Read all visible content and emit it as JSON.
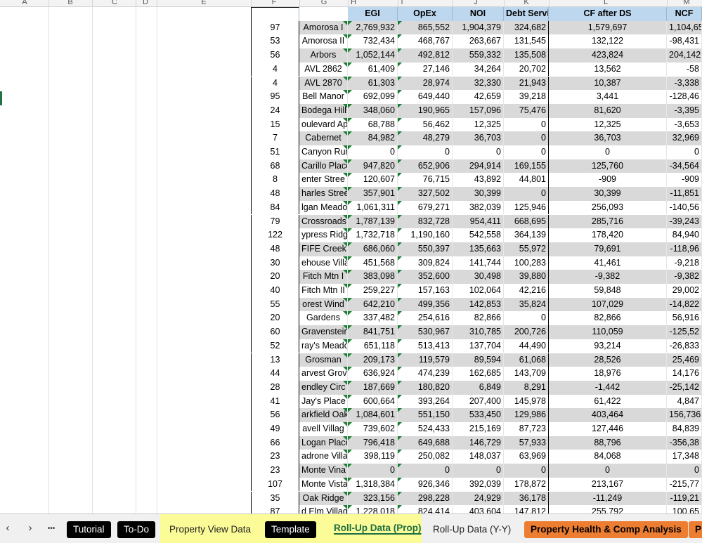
{
  "sheet": {
    "col_letters": [
      "A",
      "B",
      "C",
      "D",
      "E",
      "F",
      "G",
      "H",
      "I",
      "J",
      "K",
      "L",
      "M"
    ],
    "headers": {
      "egi": "EGI",
      "opex": "OpEx",
      "noi": "NOI",
      "debt": "Debt Service",
      "cf": "CF after DS",
      "ncf": "NCF"
    },
    "rows": [
      {
        "count": "97",
        "name": "Amorosa I",
        "egi": "2,769,932",
        "opex": "865,552",
        "noi": "1,904,379",
        "debt": "324,682",
        "cf": "1,579,697",
        "ncf": "1,104,65"
      },
      {
        "count": "53",
        "name": "Amorosa II",
        "egi": "732,434",
        "opex": "468,767",
        "noi": "263,667",
        "debt": "131,545",
        "cf": "132,122",
        "ncf": "-98,431"
      },
      {
        "count": "56",
        "name": "Arbors",
        "egi": "1,052,144",
        "opex": "492,812",
        "noi": "559,332",
        "debt": "135,508",
        "cf": "423,824",
        "ncf": "204,142"
      },
      {
        "count": "4",
        "name": "AVL 2862",
        "egi": "61,409",
        "opex": "27,146",
        "noi": "34,264",
        "debt": "20,702",
        "cf": "13,562",
        "ncf": "-58"
      },
      {
        "count": "4",
        "name": "AVL 2870",
        "egi": "61,303",
        "opex": "28,974",
        "noi": "32,330",
        "debt": "21,943",
        "cf": "10,387",
        "ncf": "-3,338"
      },
      {
        "count": "95",
        "name": "Bell Manor",
        "egi": "692,099",
        "opex": "649,440",
        "noi": "42,659",
        "debt": "39,218",
        "cf": "3,441",
        "ncf": "-128,46"
      },
      {
        "count": "24",
        "name": "Bodega Hills",
        "egi": "348,060",
        "opex": "190,965",
        "noi": "157,096",
        "debt": "75,476",
        "cf": "81,620",
        "ncf": "-3,395"
      },
      {
        "count": "15",
        "name": "oulevard Ap",
        "egi": "68,788",
        "opex": "56,462",
        "noi": "12,325",
        "debt": "0",
        "cf": "12,325",
        "ncf": "-3,653"
      },
      {
        "count": "7",
        "name": "Cabernet",
        "egi": "84,982",
        "opex": "48,279",
        "noi": "36,703",
        "debt": "0",
        "cf": "36,703",
        "ncf": "32,969"
      },
      {
        "count": "51",
        "name": "Canyon Run",
        "egi": "0",
        "opex": "0",
        "noi": "0",
        "debt": "0",
        "cf": "0",
        "ncf": "0"
      },
      {
        "count": "68",
        "name": "Carillo Place",
        "egi": "947,820",
        "opex": "652,906",
        "noi": "294,914",
        "debt": "169,155",
        "cf": "125,760",
        "ncf": "-34,564"
      },
      {
        "count": "8",
        "name": "enter Stree",
        "egi": "120,607",
        "opex": "76,715",
        "noi": "43,892",
        "debt": "44,801",
        "cf": "-909",
        "ncf": "-909"
      },
      {
        "count": "48",
        "name": "harles Stree",
        "egi": "357,901",
        "opex": "327,502",
        "noi": "30,399",
        "debt": "0",
        "cf": "30,399",
        "ncf": "-11,851"
      },
      {
        "count": "84",
        "name": "lgan Meado",
        "egi": "1,061,311",
        "opex": "679,271",
        "noi": "382,039",
        "debt": "125,946",
        "cf": "256,093",
        "ncf": "-140,56"
      },
      {
        "count": "79",
        "name": "Crossroads",
        "egi": "1,787,139",
        "opex": "832,728",
        "noi": "954,411",
        "debt": "668,695",
        "cf": "285,716",
        "ncf": "-39,243"
      },
      {
        "count": "122",
        "name": "ypress Ridg",
        "egi": "1,732,718",
        "opex": "1,190,160",
        "noi": "542,558",
        "debt": "364,139",
        "cf": "178,420",
        "ncf": "84,940"
      },
      {
        "count": "48",
        "name": "FIFE Creek",
        "egi": "686,060",
        "opex": "550,397",
        "noi": "135,663",
        "debt": "55,972",
        "cf": "79,691",
        "ncf": "-118,96"
      },
      {
        "count": "30",
        "name": "ehouse Villa",
        "egi": "451,568",
        "opex": "309,824",
        "noi": "141,744",
        "debt": "100,283",
        "cf": "41,461",
        "ncf": "-9,218"
      },
      {
        "count": "20",
        "name": "Fitch Mtn I",
        "egi": "383,098",
        "opex": "352,600",
        "noi": "30,498",
        "debt": "39,880",
        "cf": "-9,382",
        "ncf": "-9,382"
      },
      {
        "count": "40",
        "name": "Fitch Mtn II",
        "egi": "259,227",
        "opex": "157,163",
        "noi": "102,064",
        "debt": "42,216",
        "cf": "59,848",
        "ncf": "29,002"
      },
      {
        "count": "55",
        "name": "orest Wind",
        "egi": "642,210",
        "opex": "499,356",
        "noi": "142,853",
        "debt": "35,824",
        "cf": "107,029",
        "ncf": "-14,822"
      },
      {
        "count": "20",
        "name": "Gardens",
        "egi": "337,482",
        "opex": "254,616",
        "noi": "82,866",
        "debt": "0",
        "cf": "82,866",
        "ncf": "56,916"
      },
      {
        "count": "60",
        "name": "Gravenstein",
        "egi": "841,751",
        "opex": "530,967",
        "noi": "310,785",
        "debt": "200,726",
        "cf": "110,059",
        "ncf": "-125,52"
      },
      {
        "count": "52",
        "name": "ray's Meado",
        "egi": "651,118",
        "opex": "513,413",
        "noi": "137,704",
        "debt": "44,490",
        "cf": "93,214",
        "ncf": "-26,833"
      },
      {
        "count": "13",
        "name": "Grosman",
        "egi": "209,173",
        "opex": "119,579",
        "noi": "89,594",
        "debt": "61,068",
        "cf": "28,526",
        "ncf": "25,469"
      },
      {
        "count": "44",
        "name": "arvest Grov",
        "egi": "636,924",
        "opex": "474,239",
        "noi": "162,685",
        "debt": "143,709",
        "cf": "18,976",
        "ncf": "14,176"
      },
      {
        "count": "28",
        "name": "endley Circ",
        "egi": "187,669",
        "opex": "180,820",
        "noi": "6,849",
        "debt": "8,291",
        "cf": "-1,442",
        "ncf": "-25,142"
      },
      {
        "count": "41",
        "name": "Jay's Place",
        "egi": "600,664",
        "opex": "393,264",
        "noi": "207,400",
        "debt": "145,978",
        "cf": "61,422",
        "ncf": "4,847"
      },
      {
        "count": "56",
        "name": "arkfield Oak",
        "egi": "1,084,601",
        "opex": "551,150",
        "noi": "533,450",
        "debt": "129,986",
        "cf": "403,464",
        "ncf": "156,736"
      },
      {
        "count": "49",
        "name": "avell Villag",
        "egi": "739,602",
        "opex": "524,433",
        "noi": "215,169",
        "debt": "87,723",
        "cf": "127,446",
        "ncf": "84,839"
      },
      {
        "count": "66",
        "name": "Logan Place",
        "egi": "796,418",
        "opex": "649,688",
        "noi": "146,729",
        "debt": "57,933",
        "cf": "88,796",
        "ncf": "-356,38"
      },
      {
        "count": "23",
        "name": "adrone Villa",
        "egi": "398,119",
        "opex": "250,082",
        "noi": "148,037",
        "debt": "63,969",
        "cf": "84,068",
        "ncf": "17,348"
      },
      {
        "count": "23",
        "name": "Monte Vina",
        "egi": "0",
        "opex": "0",
        "noi": "0",
        "debt": "0",
        "cf": "0",
        "ncf": "0"
      },
      {
        "count": "107",
        "name": "Monte Vista",
        "egi": "1,318,384",
        "opex": "926,346",
        "noi": "392,039",
        "debt": "178,872",
        "cf": "213,167",
        "ncf": "-215,77"
      },
      {
        "count": "35",
        "name": "Oak Ridge",
        "egi": "323,156",
        "opex": "298,228",
        "noi": "24,929",
        "debt": "36,178",
        "cf": "-11,249",
        "ncf": "-119,21"
      },
      {
        "count": "87",
        "name": "d Elm Villag",
        "egi": "1,228,018",
        "opex": "824,414",
        "noi": "403,604",
        "debt": "147,812",
        "cf": "255,792",
        "ncf": "100,65"
      }
    ]
  },
  "tabs": {
    "nav_prev": "‹",
    "nav_next": "›",
    "nav_more": "•••",
    "items": [
      {
        "label": "Tutorial",
        "style": "black"
      },
      {
        "label": "To-Do",
        "style": "black"
      },
      {
        "label": "Property View Data",
        "style": "plain"
      },
      {
        "label": "Template",
        "style": "black"
      },
      {
        "label": "Roll-Up Data (Prop)",
        "style": "active"
      },
      {
        "label": "Roll-Up Data (Y-Y)",
        "style": "plain"
      },
      {
        "label": "Property Health & Comp Analysis",
        "style": "orange"
      },
      {
        "label": "P",
        "style": "orange"
      }
    ]
  },
  "colors": {
    "header_fill": "#bdd7ee",
    "shade_fill": "#d9d9d9",
    "tab_highlight": "#ffff7a",
    "orange_tab": "#ed7d31"
  }
}
